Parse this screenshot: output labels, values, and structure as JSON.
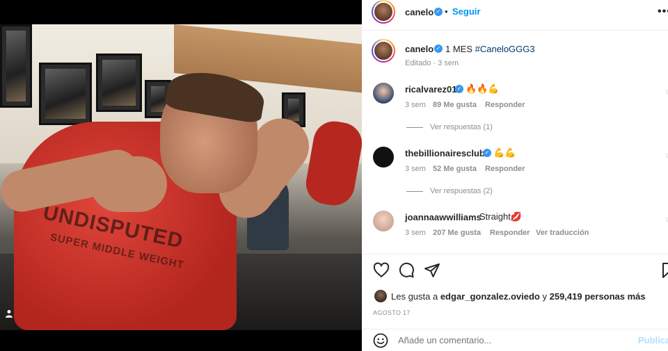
{
  "post": {
    "author": "canelo",
    "follow_label": "Seguir",
    "more_label": "•••"
  },
  "caption": {
    "author": "canelo",
    "text_prefix": "1 MES ",
    "hashtag": "#CaneloGGG3",
    "meta": "Editado · 3 sem"
  },
  "photo": {
    "shirt_text_1": "UNDISPUTED",
    "shirt_text_2": "SUPER MIDDLE WEIGHT"
  },
  "comments": [
    {
      "user": "ricalvarez01",
      "text": "🔥🔥💪",
      "time": "3 sem",
      "likes": "89 Me gusta",
      "reply": "Responder",
      "view_replies": "Ver respuestas (1)"
    },
    {
      "user": "thebillionairesclub",
      "text": "💪💪",
      "time": "3 sem",
      "likes": "52 Me gusta",
      "reply": "Responder",
      "view_replies": "Ver respuestas (2)"
    },
    {
      "user": "joannaawwilliams",
      "text": "Straight💋",
      "time": "3 sem",
      "likes": "207 Me gusta",
      "reply": "Responder",
      "translate": "Ver traducción"
    }
  ],
  "likes": {
    "prefix": "Les gusta a ",
    "user": "edgar_gonzalez.oviedo",
    "middle": " y ",
    "count": "259,419 personas más"
  },
  "date": "AGOSTO 17",
  "comment_box": {
    "placeholder": "Añade un comentario...",
    "post_label": "Publicar"
  },
  "colors": {
    "accent": "#0095f6",
    "verified": "#3897f0",
    "hashtag": "#00376b",
    "secondary_text": "#8e8e8e"
  }
}
